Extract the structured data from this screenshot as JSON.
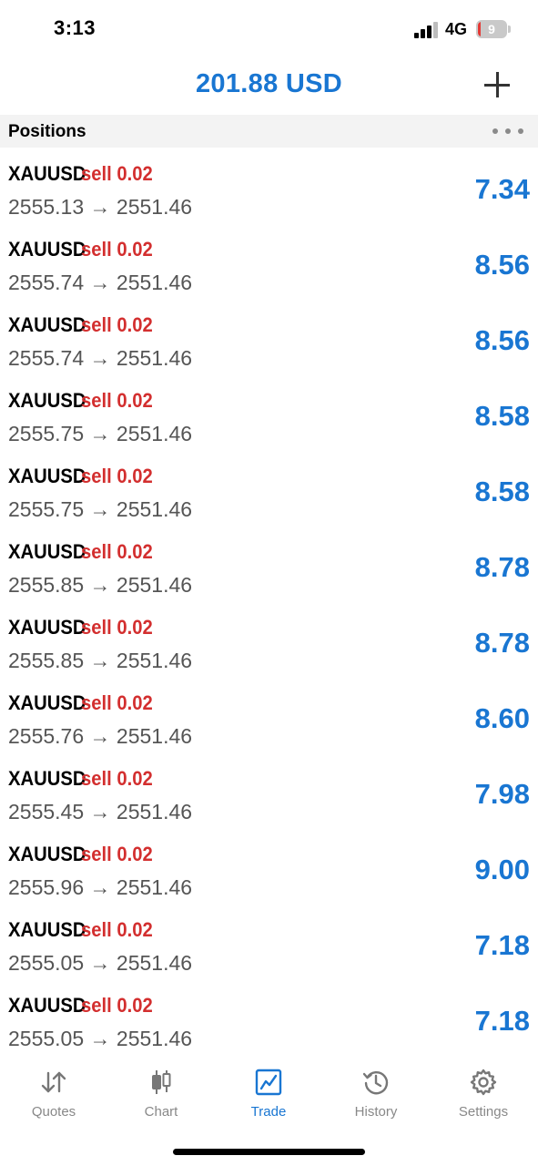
{
  "status_bar": {
    "time": "3:13",
    "network": "4G",
    "battery_level": "9"
  },
  "header": {
    "balance": "201.88 USD",
    "add_icon": "plus-icon"
  },
  "section": {
    "title": "Positions",
    "more_icon": "more-horizontal-icon"
  },
  "positions": [
    {
      "symbol": "XAUUSD",
      "type": "sell 0.02",
      "prices": "2555.13 → 2551.46",
      "profit": "7.34"
    },
    {
      "symbol": "XAUUSD",
      "type": "sell 0.02",
      "prices": "2555.74 → 2551.46",
      "profit": "8.56"
    },
    {
      "symbol": "XAUUSD",
      "type": "sell 0.02",
      "prices": "2555.74 → 2551.46",
      "profit": "8.56"
    },
    {
      "symbol": "XAUUSD",
      "type": "sell 0.02",
      "prices": "2555.75 → 2551.46",
      "profit": "8.58"
    },
    {
      "symbol": "XAUUSD",
      "type": "sell 0.02",
      "prices": "2555.75 → 2551.46",
      "profit": "8.58"
    },
    {
      "symbol": "XAUUSD",
      "type": "sell 0.02",
      "prices": "2555.85 → 2551.46",
      "profit": "8.78"
    },
    {
      "symbol": "XAUUSD",
      "type": "sell 0.02",
      "prices": "2555.85 → 2551.46",
      "profit": "8.78"
    },
    {
      "symbol": "XAUUSD",
      "type": "sell 0.02",
      "prices": "2555.76 → 2551.46",
      "profit": "8.60"
    },
    {
      "symbol": "XAUUSD",
      "type": "sell 0.02",
      "prices": "2555.45 → 2551.46",
      "profit": "7.98"
    },
    {
      "symbol": "XAUUSD",
      "type": "sell 0.02",
      "prices": "2555.96 → 2551.46",
      "profit": "9.00"
    },
    {
      "symbol": "XAUUSD",
      "type": "sell 0.02",
      "prices": "2555.05 → 2551.46",
      "profit": "7.18"
    },
    {
      "symbol": "XAUUSD",
      "type": "sell 0.02",
      "prices": "2555.05 → 2551.46",
      "profit": "7.18"
    }
  ],
  "tabs": [
    {
      "label": "Quotes",
      "icon": "quotes-arrows-icon",
      "active": false
    },
    {
      "label": "Chart",
      "icon": "candlestick-icon",
      "active": false
    },
    {
      "label": "Trade",
      "icon": "trade-chart-icon",
      "active": true
    },
    {
      "label": "History",
      "icon": "history-clock-icon",
      "active": false
    },
    {
      "label": "Settings",
      "icon": "gear-icon",
      "active": false
    }
  ],
  "colors": {
    "accent": "#1976d2",
    "sell": "#d32f2f",
    "battery_low": "#e53935"
  }
}
